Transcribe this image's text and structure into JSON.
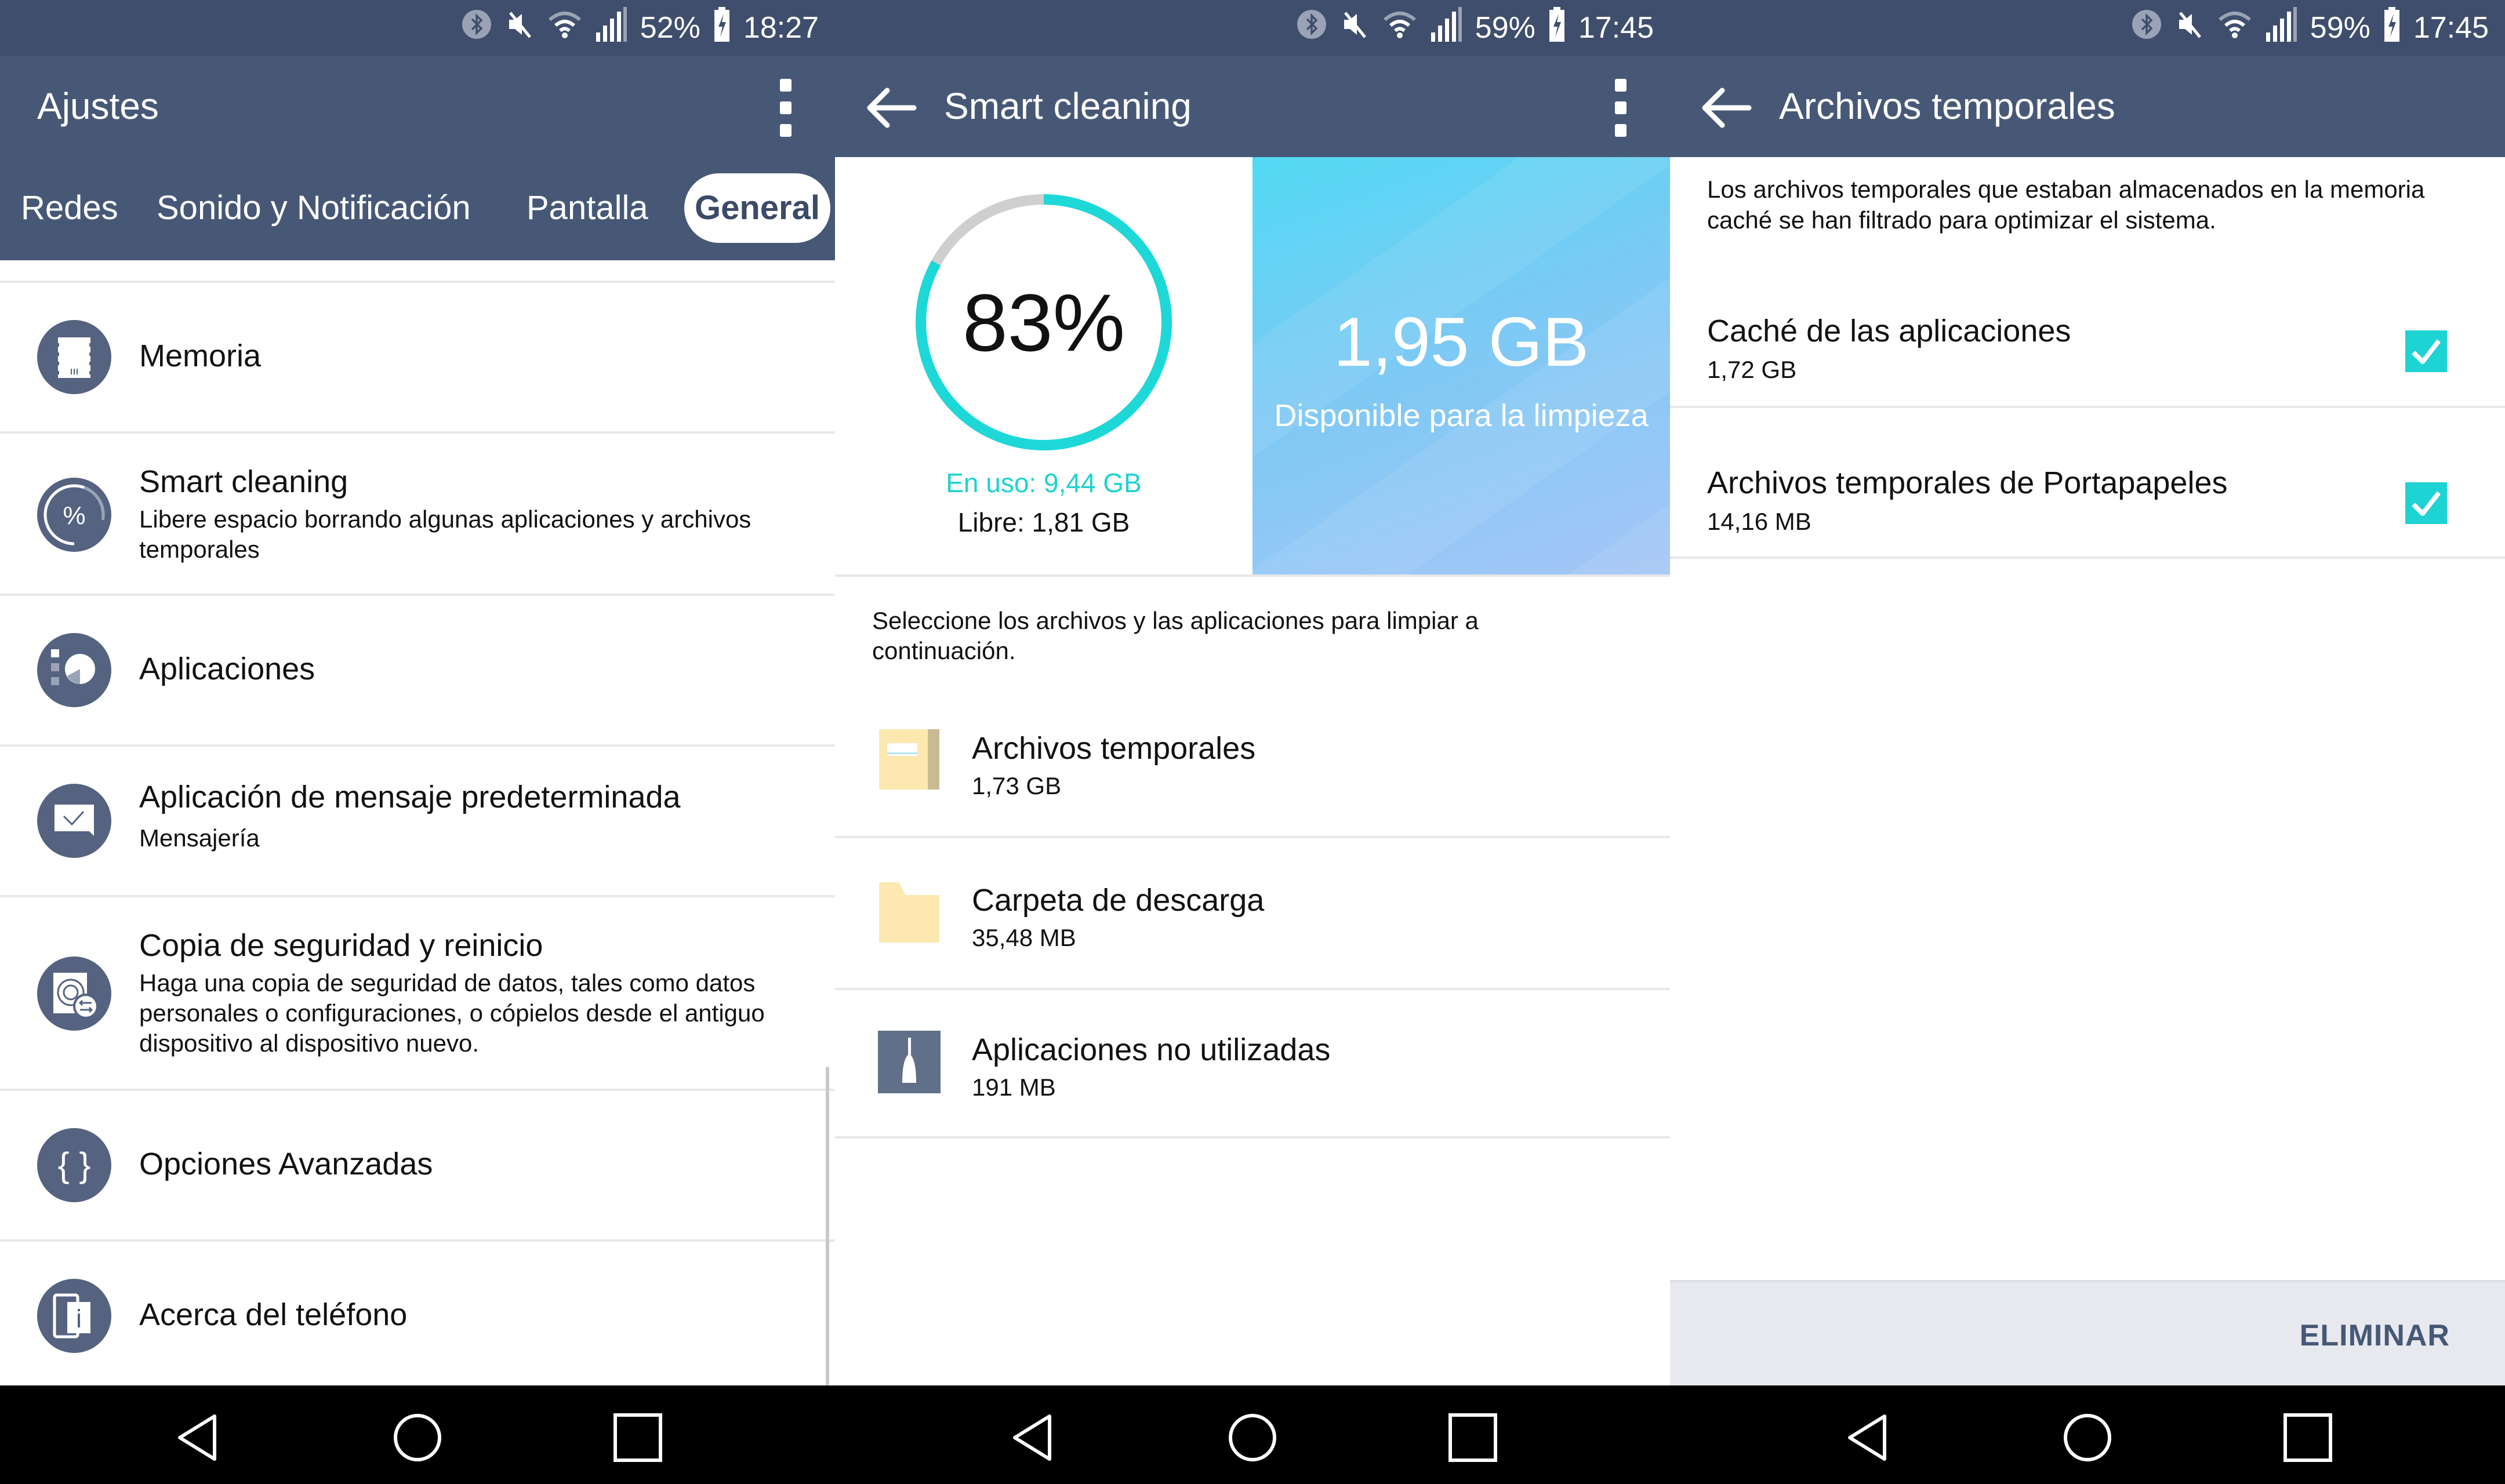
{
  "screens": [
    {
      "status": {
        "battery": "52%",
        "time": "18:27"
      },
      "title": "Ajustes",
      "tabs": [
        {
          "label": "Redes",
          "active": false
        },
        {
          "label": "Sonido y Notificación",
          "active": false
        },
        {
          "label": "Pantalla",
          "active": false
        },
        {
          "label": "General",
          "active": true
        }
      ],
      "items": [
        {
          "icon": "memory-chip-icon",
          "title": "Memoria",
          "subtitle": ""
        },
        {
          "icon": "smart-cleaning-percent-icon",
          "title": "Smart cleaning",
          "subtitle": "Libere espacio borrando algunas aplicaciones y archivos temporales"
        },
        {
          "icon": "apps-pie-icon",
          "title": "Aplicaciones",
          "subtitle": ""
        },
        {
          "icon": "message-icon",
          "title": "Aplicación de mensaje predeterminada",
          "subtitle": "Mensajería"
        },
        {
          "icon": "backup-restore-icon",
          "title": "Copia de seguridad y reinicio",
          "subtitle": "Haga una copia de seguridad de datos, tales como datos personales o configuraciones, o cópielos desde el antiguo dispositivo al dispositivo nuevo."
        },
        {
          "icon": "code-braces-icon",
          "title": "Opciones Avanzadas",
          "subtitle": ""
        },
        {
          "icon": "phone-info-icon",
          "title": "Acerca del teléfono",
          "subtitle": ""
        }
      ]
    },
    {
      "status": {
        "battery": "59%",
        "time": "17:45"
      },
      "title": "Smart cleaning",
      "gauge": {
        "percent_label": "83%",
        "used_fraction": 0.83,
        "used_label": "En uso: 9,44  GB",
        "free_label": "Libre: 1,81  GB"
      },
      "available": {
        "value": "1,95  GB",
        "label": "Disponible para la limpieza"
      },
      "instruction": "Seleccione los archivos y las aplicaciones para limpiar a continuación.",
      "items": [
        {
          "icon": "temp-files-folder-icon",
          "title": "Archivos temporales",
          "size": "1,73  GB"
        },
        {
          "icon": "download-folder-icon",
          "title": "Carpeta de descarga",
          "size": "35,48  MB"
        },
        {
          "icon": "broom-icon",
          "title": "Aplicaciones no utilizadas",
          "size": "191  MB"
        }
      ]
    },
    {
      "status": {
        "battery": "59%",
        "time": "17:45"
      },
      "title": "Archivos temporales",
      "description": "Los archivos temporales que estaban almacenados en la memoria caché se han filtrado para optimizar el sistema.",
      "items": [
        {
          "title": "Caché de las aplicaciones",
          "size": "1,72  GB",
          "checked": true
        },
        {
          "title": "Archivos temporales de Portapapeles",
          "size": "14,16  MB",
          "checked": true
        }
      ],
      "action": "ELIMINAR"
    }
  ],
  "colors": {
    "header": "#475877",
    "statusbar": "#3f4e6c",
    "accent": "#1ed3d3",
    "icon_bg": "#556381"
  }
}
